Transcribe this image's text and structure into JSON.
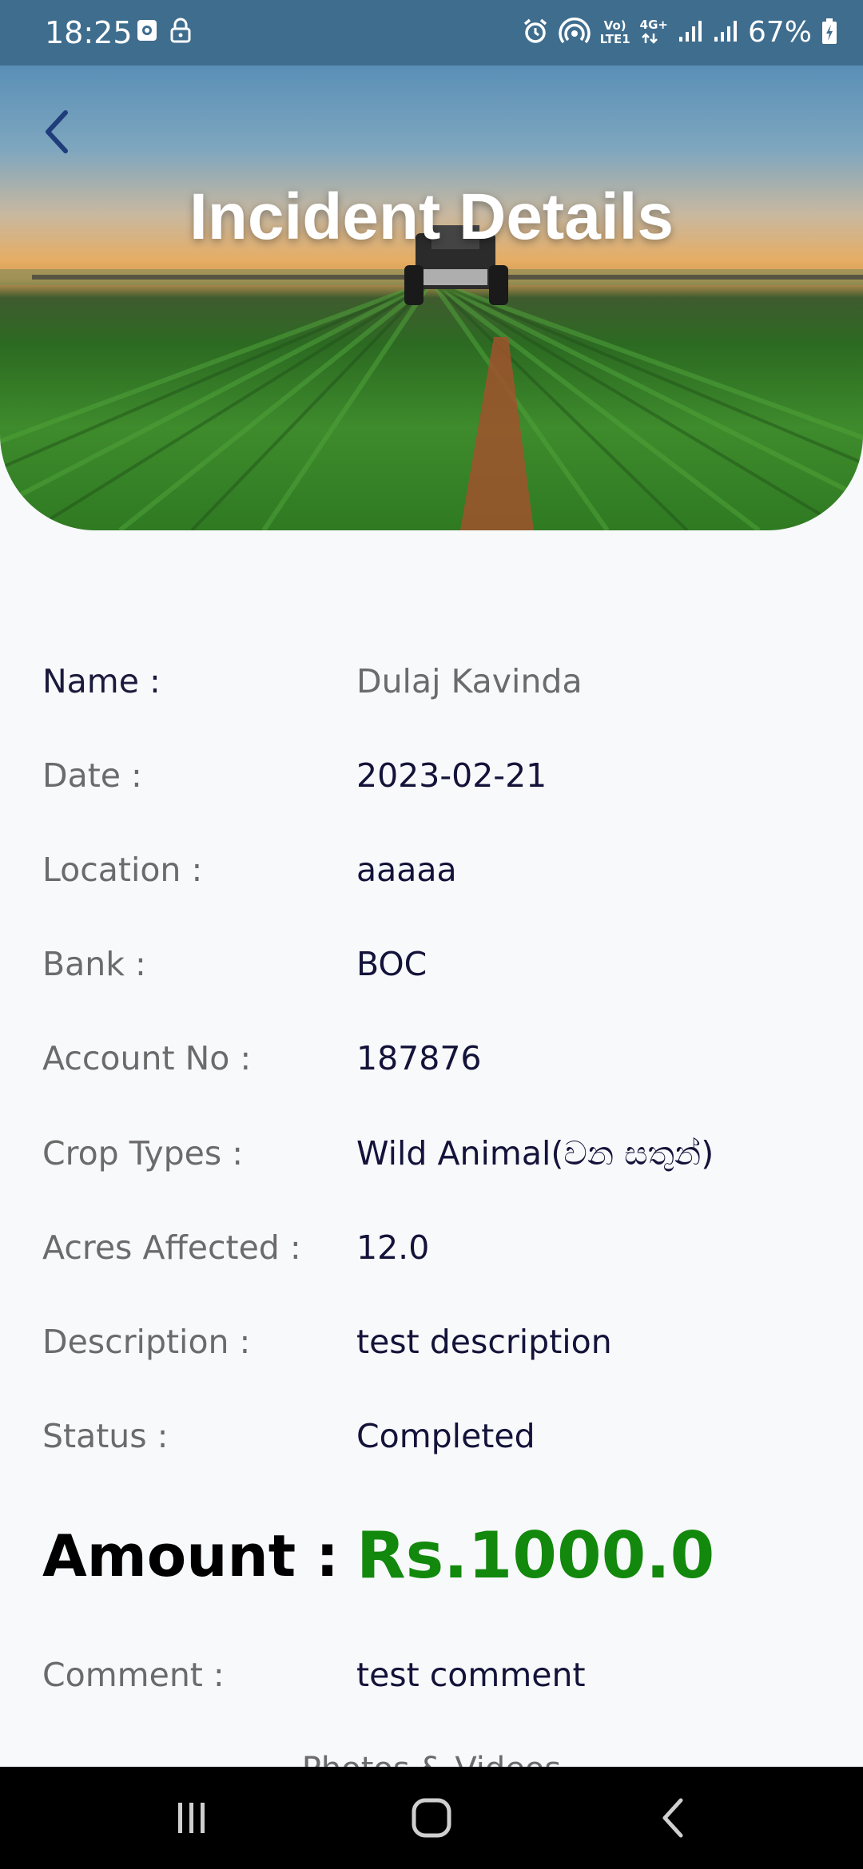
{
  "status_bar": {
    "time": "18:25",
    "network_top": "Vo)",
    "network_bottom": "LTE1",
    "data_top": "4G+",
    "battery": "67%",
    "icons": [
      "screenshot-icon",
      "lock-icon",
      "alarm-icon",
      "hotspot-icon",
      "volte-icon",
      "data-4g-icon",
      "signal-icon",
      "signal-icon",
      "battery-charging-icon"
    ]
  },
  "header": {
    "title": "Incident Details",
    "back_icon": "chevron-left-icon"
  },
  "details": [
    {
      "key": "name",
      "label": "Name :",
      "value": "Dulaj Kavinda"
    },
    {
      "key": "date",
      "label": "Date :",
      "value": "2023-02-21"
    },
    {
      "key": "location",
      "label": "Location :",
      "value": "aaaaa"
    },
    {
      "key": "bank",
      "label": "Bank :",
      "value": "BOC"
    },
    {
      "key": "account",
      "label": "Account No :",
      "value": "187876"
    },
    {
      "key": "crop",
      "label": "Crop Types :",
      "value": "Wild Animal(වන සතුන්)"
    },
    {
      "key": "acres",
      "label": "Acres Affected :",
      "value": "12.0"
    },
    {
      "key": "description",
      "label": "Description :",
      "value": "test description"
    },
    {
      "key": "status",
      "label": "Status :",
      "value": "Completed"
    }
  ],
  "amount": {
    "label": "Amount :",
    "value": "Rs.1000.0",
    "color": "#12880d"
  },
  "comment": {
    "label": "Comment :",
    "value": "test comment"
  },
  "next_section": {
    "title": "Photos & Videos"
  },
  "nav_bar": {
    "icons": [
      "recent-apps-icon",
      "home-icon",
      "back-icon"
    ]
  },
  "colors": {
    "status_bar": "#3f6d8e",
    "back_icon": "#1e3d7a",
    "label": "#6b6b6b",
    "value": "#13133a",
    "amount": "#12880d",
    "background": "#f8f9fb"
  }
}
